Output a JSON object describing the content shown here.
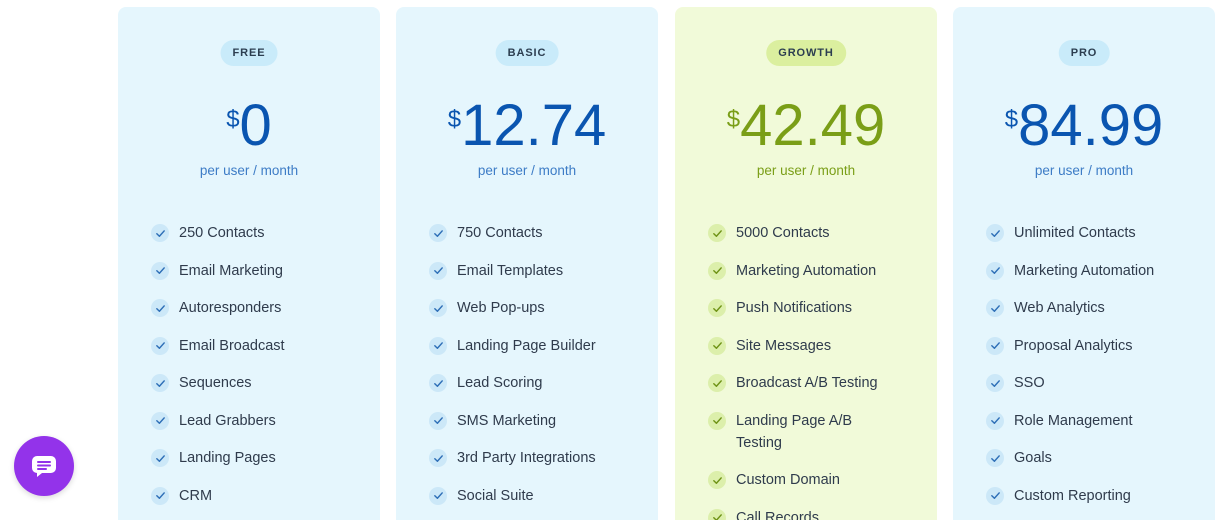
{
  "plans": [
    {
      "name": "FREE",
      "currency": "$",
      "price": "0",
      "period": "per user / month",
      "features": [
        "250 Contacts",
        "Email Marketing",
        "Autoresponders",
        "Email Broadcast",
        "Sequences",
        "Lead Grabbers",
        "Landing Pages",
        "CRM"
      ]
    },
    {
      "name": "BASIC",
      "currency": "$",
      "price": "12.74",
      "period": "per user / month",
      "features": [
        "750 Contacts",
        "Email Templates",
        "Web Pop-ups",
        "Landing Page Builder",
        "Lead Scoring",
        "SMS Marketing",
        "3rd Party Integrations",
        "Social Suite"
      ]
    },
    {
      "name": "GROWTH",
      "currency": "$",
      "price": "42.49",
      "period": "per user / month",
      "features": [
        "5000 Contacts",
        "Marketing Automation",
        "Push Notifications",
        "Site Messages",
        "Broadcast A/B Testing",
        "Landing Page A/B Testing",
        "Custom Domain",
        "Call Records"
      ]
    },
    {
      "name": "PRO",
      "currency": "$",
      "price": "84.99",
      "period": "per user / month",
      "features": [
        "Unlimited Contacts",
        "Marketing Automation",
        "Web Analytics",
        "Proposal Analytics",
        "SSO",
        "Role Management",
        "Goals",
        "Custom Reporting"
      ]
    }
  ],
  "colors": {
    "card_blue": "#e5f6fd",
    "card_green": "#f1fad9",
    "price_blue": "#0a55b0",
    "price_green": "#7a9e17",
    "chat_button": "#9333ea"
  },
  "icons": {
    "feature": "check-icon",
    "chat": "chat-bubble-icon"
  }
}
